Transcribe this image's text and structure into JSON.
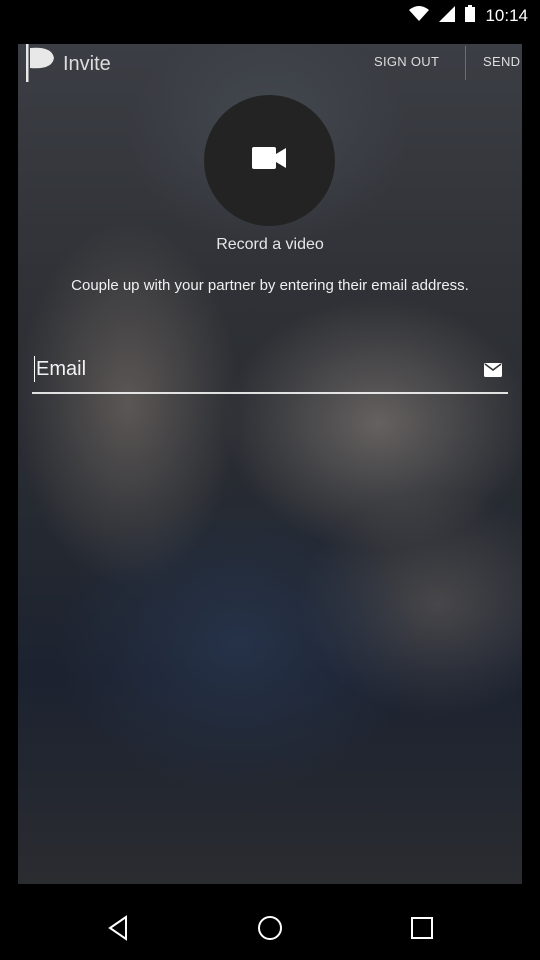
{
  "status_bar": {
    "time": "10:14",
    "icons": [
      "wifi-icon",
      "signal-icon",
      "battery-icon"
    ]
  },
  "header": {
    "title": "Invite",
    "sign_out_label": "SIGN OUT",
    "send_label": "SEND"
  },
  "record": {
    "label": "Record a video",
    "icon": "video-camera-icon"
  },
  "description": "Couple up with your partner by entering their email address.",
  "email_field": {
    "placeholder": "Email",
    "value": "",
    "icon": "mail-icon"
  },
  "nav": {
    "icons": [
      "back-icon",
      "home-icon",
      "recents-icon"
    ]
  },
  "colors": {
    "background": "#000000",
    "record_button": "#232323",
    "text": "#ffffff"
  }
}
